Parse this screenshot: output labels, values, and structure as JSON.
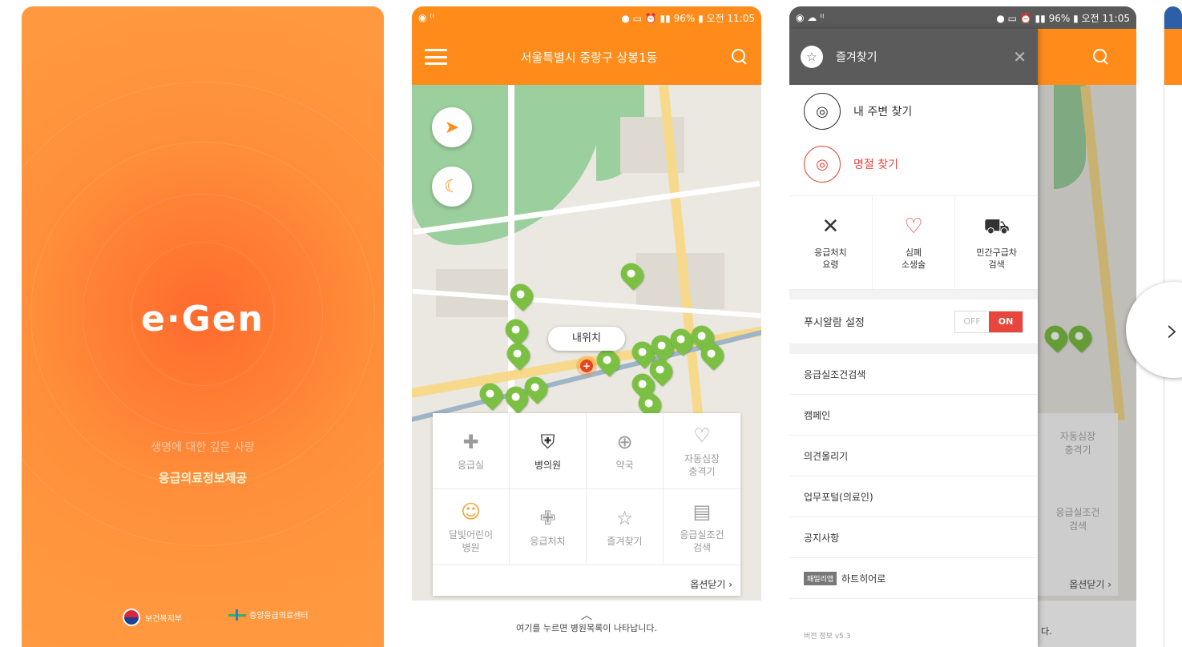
{
  "splash": {
    "logo": "e·Gen",
    "slogan_line1": "생명에 대한 깊은 사랑",
    "slogan_line2": "응급의료정보제공",
    "org1": "보건복지부",
    "org2": "중앙응급의료센터"
  },
  "map_screen": {
    "status": {
      "battery": "96%",
      "time": "오전 11:05"
    },
    "location_title": "서울특별시 중랑구 상봉1동",
    "my_location_label": "내위치",
    "grid": [
      {
        "icon": "emergency-room-icon",
        "glyph": "✚",
        "label": "응급실"
      },
      {
        "icon": "hospital-icon",
        "glyph": "⛨",
        "label": "병의원"
      },
      {
        "icon": "pharmacy-icon",
        "glyph": "⊕",
        "label": "약국"
      },
      {
        "icon": "defibrillator-icon",
        "glyph": "♡",
        "label": "자동심장\n충격기"
      },
      {
        "icon": "moon-child-icon",
        "glyph": "☺",
        "label": "달빛어린이\n병원"
      },
      {
        "icon": "first-aid-kit-icon",
        "glyph": "✙",
        "label": "응급처치"
      },
      {
        "icon": "star-icon",
        "glyph": "☆",
        "label": "즐겨찾기"
      },
      {
        "icon": "er-condition-icon",
        "glyph": "▤",
        "label": "응급실조건\n검색"
      }
    ],
    "options_close": "옵션닫기 ›",
    "hint_chevron": "︿",
    "hint_text": "여기를 누르면 병원목록이 나타납니다."
  },
  "drawer_screen": {
    "status": {
      "battery": "96%",
      "time": "오전 11:05"
    },
    "favorites_title": "즐겨찾기",
    "nearby": "내 주변 찾기",
    "holiday": "명절 찾기",
    "tools": [
      {
        "icon": "bandage-icon",
        "glyph": "✕",
        "label": "응급처치\n요령"
      },
      {
        "icon": "heart-hands-icon",
        "glyph": "♡",
        "label": "심폐\n소생술"
      },
      {
        "icon": "ambulance-icon",
        "glyph": "⛟",
        "label": "민간구급차\n검색"
      }
    ],
    "push_label": "푸시알람 설정",
    "toggle_off": "OFF",
    "toggle_on": "ON",
    "menu": [
      "응급실조건검색",
      "캠페인",
      "의견올리기",
      "업무포털(의료인)",
      "공지사항"
    ],
    "family_tag": "패밀리앱",
    "family_app": "하트히어로",
    "version": "버전 정보  v5.3",
    "behind_labels": [
      "자동심장\n충격기",
      "응급실조건\n검색",
      "옵션닫기 ›",
      "다."
    ]
  },
  "nav": {
    "next_glyph": "›"
  },
  "colors": {
    "primary": "#ff8c1a",
    "accent": "#e8453c",
    "drawer_header": "#5b5b5b",
    "pin": "#7bc043"
  }
}
